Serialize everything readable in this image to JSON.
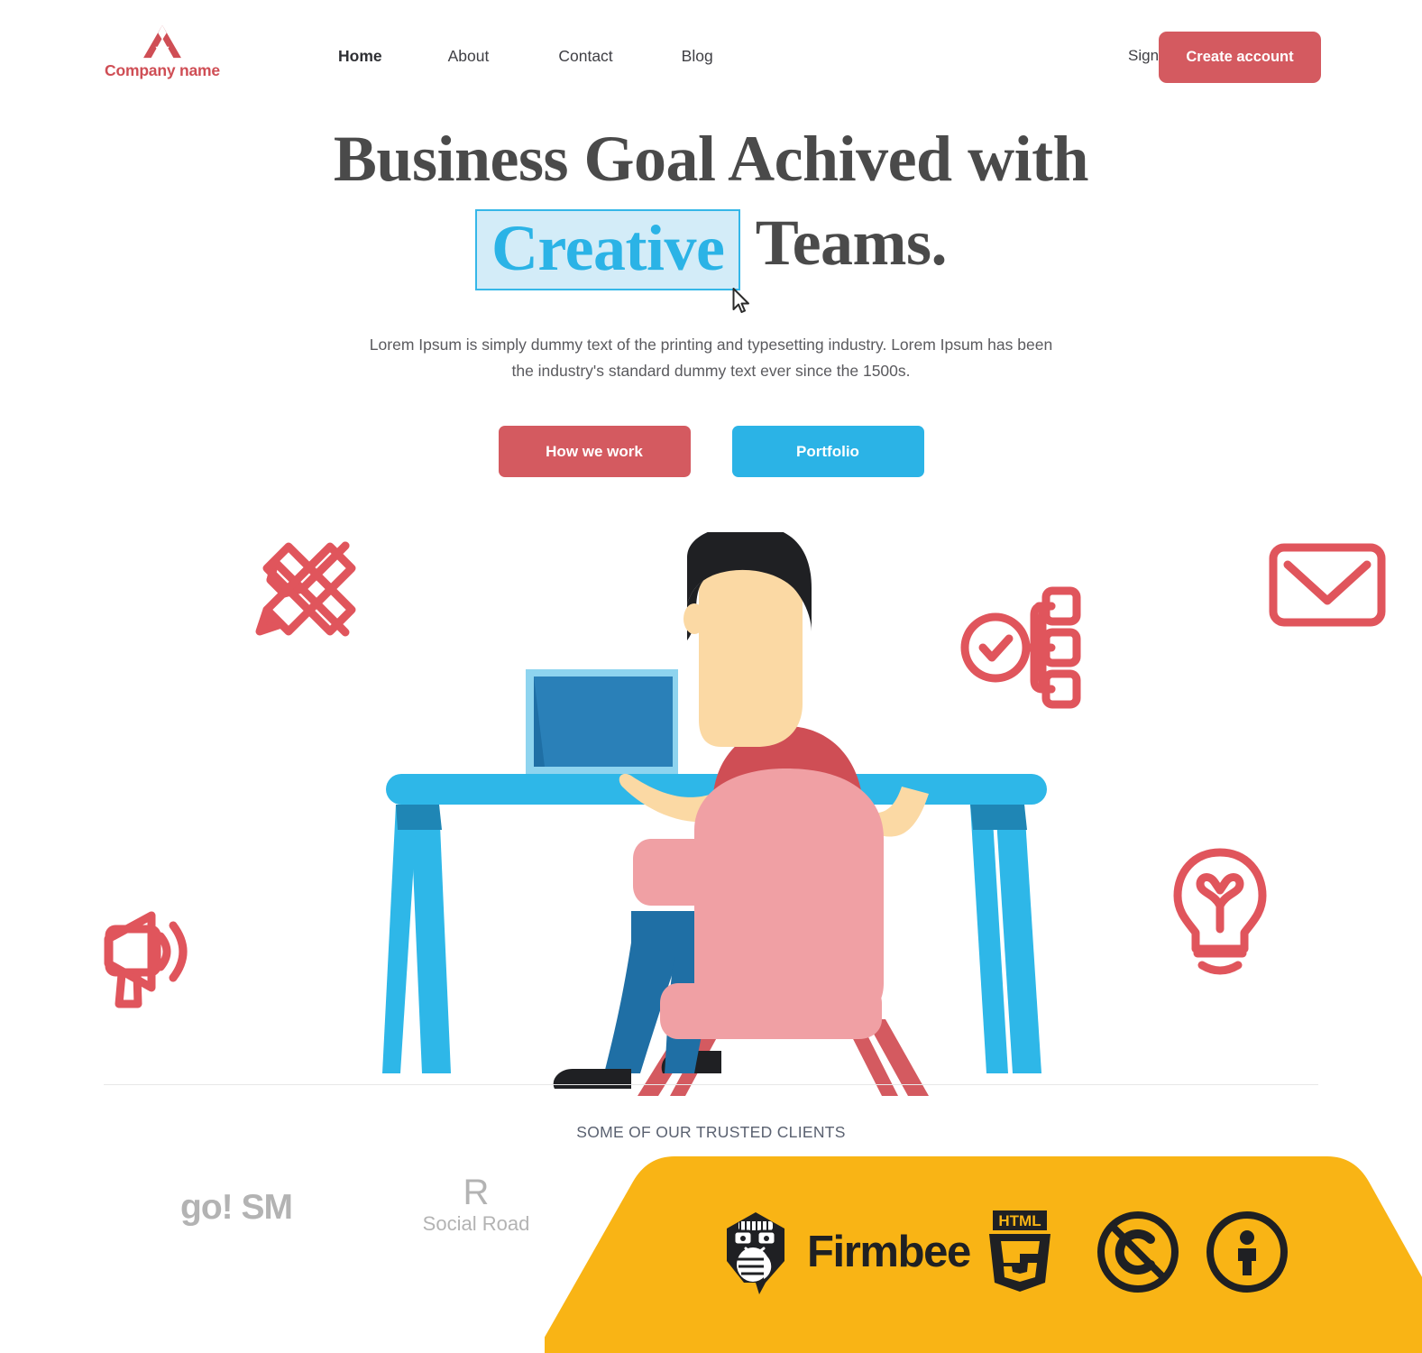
{
  "header": {
    "brand": {
      "mark": "A-logo-icon",
      "name": "Company name",
      "color": "#cf4e55"
    },
    "nav": [
      {
        "label": "Home",
        "active": true
      },
      {
        "label": "About",
        "active": false
      },
      {
        "label": "Contact",
        "active": false
      },
      {
        "label": "Blog",
        "active": false
      }
    ],
    "sign_in_label": "Sign in",
    "create_account_label": "Create account",
    "create_account_color": "#d45a60"
  },
  "hero": {
    "title_line1": "Business Goal Achived with",
    "title_highlight": "Creative",
    "title_after_highlight": "Teams.",
    "highlight_bg": "#d3ecf8",
    "highlight_border": "#35b7e8",
    "highlight_text_color": "#2bb3e6",
    "cursor": "mouse-pointer-icon",
    "subtitle": "Lorem Ipsum is simply dummy text of the printing and typesetting industry. Lorem Ipsum has been the industry's standard dummy text ever since the 1500s.",
    "buttons": [
      {
        "label": "How we work",
        "color": "#d45a60"
      },
      {
        "label": "Portfolio",
        "color": "#2bb3e6"
      }
    ]
  },
  "illustration": {
    "scene": "man-working-at-desk-illustration",
    "colors": {
      "desk": "#2eb7e8",
      "desk_shadow": "#1f86b5",
      "chair": "#f0a0a4",
      "chair_legs": "#d45a60",
      "shirt": "#cf4e55",
      "pants": "#1f6fa5",
      "skin": "#fbd9a4",
      "hair": "#1f2023",
      "shoes": "#1f2023",
      "laptop_screen": "#1f6fa5",
      "laptop_body": "#8ed4ef"
    },
    "decor_icons": [
      {
        "name": "pencil-ruler-icon",
        "color": "#e0555c"
      },
      {
        "name": "envelope-icon",
        "color": "#e0555c"
      },
      {
        "name": "workflow-check-icon",
        "color": "#e0555c"
      },
      {
        "name": "lightbulb-heart-icon",
        "color": "#e0555c"
      },
      {
        "name": "megaphone-icon",
        "color": "#e0555c"
      }
    ]
  },
  "clients": {
    "title": "SOME OF OUR TRUSTED CLIENTS",
    "logos": [
      {
        "name": "go-sm-logo",
        "text": "go! SM"
      },
      {
        "name": "social-road-logo",
        "mark": "R",
        "text": "Social Road"
      }
    ],
    "banner": {
      "background": "#f9b415",
      "items": [
        {
          "name": "firmbee-logo",
          "text": "Firmbee"
        },
        {
          "name": "html5-logo",
          "text": "HTML"
        },
        {
          "name": "no-copyright-icon",
          "text": ""
        },
        {
          "name": "attribution-person-icon",
          "text": ""
        }
      ]
    }
  }
}
